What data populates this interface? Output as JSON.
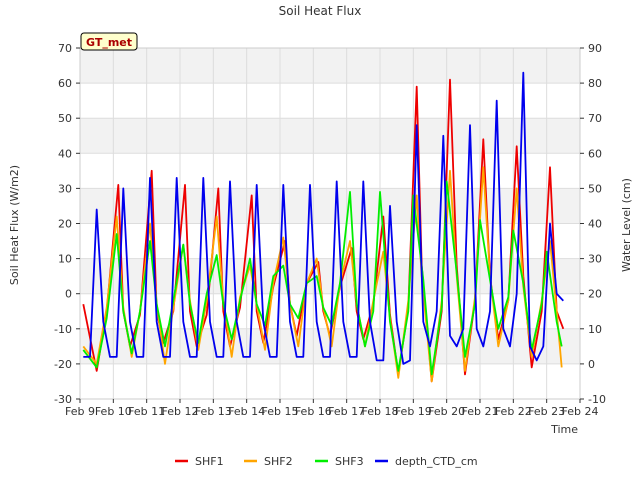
{
  "chart_data": {
    "type": "line",
    "title": "Soil Heat Flux",
    "xlabel": "Time",
    "ylabel": "Soil Heat Flux (W/m2)",
    "y2label": "Water Level (cm)",
    "badge": "GT_met",
    "ylim": [
      -30,
      70
    ],
    "y2lim": [
      -10,
      90
    ],
    "yticks": [
      -30,
      -20,
      -10,
      0,
      10,
      20,
      30,
      40,
      50,
      60,
      70
    ],
    "y2ticks": [
      -10,
      0,
      10,
      20,
      30,
      40,
      50,
      60,
      70,
      80,
      90
    ],
    "xlim": [
      9,
      24
    ],
    "xticks": [
      {
        "x": 9,
        "label": "Feb 9"
      },
      {
        "x": 10,
        "label": "Feb 10"
      },
      {
        "x": 11,
        "label": "Feb 11"
      },
      {
        "x": 12,
        "label": "Feb 12"
      },
      {
        "x": 13,
        "label": "Feb 13"
      },
      {
        "x": 14,
        "label": "Feb 14"
      },
      {
        "x": 15,
        "label": "Feb 15"
      },
      {
        "x": 16,
        "label": "Feb 16"
      },
      {
        "x": 17,
        "label": "Feb 17"
      },
      {
        "x": 18,
        "label": "Feb 18"
      },
      {
        "x": 19,
        "label": "Feb 19"
      },
      {
        "x": 20,
        "label": "Feb 20"
      },
      {
        "x": 21,
        "label": "Feb 21"
      },
      {
        "x": 22,
        "label": "Feb 22"
      },
      {
        "x": 23,
        "label": "Feb 23"
      },
      {
        "x": 24,
        "label": "Feb 24"
      }
    ],
    "grid": true,
    "legend_position": "bottom",
    "series": [
      {
        "name": "SHF1",
        "color": "#ee0000",
        "axis": "left",
        "x": [
          9.1,
          9.5,
          9.8,
          10.15,
          10.3,
          10.5,
          10.8,
          11.15,
          11.3,
          11.5,
          11.8,
          12.15,
          12.3,
          12.5,
          12.8,
          13.15,
          13.3,
          13.5,
          13.8,
          14.15,
          14.3,
          14.5,
          14.8,
          15.15,
          15.3,
          15.5,
          15.8,
          16.15,
          16.3,
          16.5,
          16.8,
          17.15,
          17.3,
          17.5,
          17.8,
          18.1,
          18.3,
          18.55,
          18.85,
          19.1,
          19.25,
          19.55,
          19.85,
          20.1,
          20.3,
          20.55,
          20.85,
          21.1,
          21.3,
          21.55,
          21.85,
          22.1,
          22.3,
          22.55,
          22.85,
          23.1,
          23.3,
          23.5
        ],
        "y": [
          -3,
          -22,
          -5,
          31,
          -5,
          -15,
          -6,
          35,
          -5,
          -14,
          -5,
          31,
          -5,
          -15,
          -6,
          30,
          -5,
          -15,
          -4,
          28,
          -5,
          -14,
          2,
          15,
          -3,
          -12,
          3,
          9,
          -5,
          -12,
          2,
          13,
          -5,
          -13,
          -3,
          22,
          -6,
          -23,
          -4,
          59,
          8,
          -25,
          -5,
          61,
          8,
          -23,
          -2,
          44,
          5,
          -13,
          -2,
          42,
          5,
          -21,
          -5,
          36,
          -5,
          -10
        ]
      },
      {
        "name": "SHF2",
        "color": "#ffa500",
        "axis": "left",
        "x": [
          9.1,
          9.5,
          9.8,
          10.1,
          10.3,
          10.55,
          10.8,
          11.1,
          11.3,
          11.55,
          11.8,
          12.1,
          12.3,
          12.55,
          12.8,
          13.1,
          13.3,
          13.55,
          13.8,
          14.1,
          14.3,
          14.55,
          14.8,
          15.1,
          15.3,
          15.55,
          15.8,
          16.1,
          16.3,
          16.55,
          16.8,
          17.1,
          17.3,
          17.55,
          17.8,
          18.1,
          18.3,
          18.55,
          18.85,
          19.1,
          19.25,
          19.55,
          19.85,
          20.1,
          20.3,
          20.55,
          20.85,
          21.1,
          21.3,
          21.55,
          21.85,
          22.1,
          22.3,
          22.55,
          22.85,
          23.1,
          23.3,
          23.45
        ],
        "y": [
          -15,
          -20,
          -4,
          22,
          -4,
          -18,
          -5,
          20,
          -3,
          -20,
          -4,
          14,
          -2,
          -16,
          -2,
          22,
          -2,
          -18,
          -1,
          8,
          -3,
          -16,
          3,
          16,
          -3,
          -15,
          3,
          10,
          -4,
          -15,
          3,
          15,
          -3,
          -15,
          -2,
          12,
          -7,
          -24,
          -2,
          28,
          5,
          -25,
          -2,
          35,
          5,
          -22,
          -1,
          36,
          5,
          -15,
          -2,
          30,
          2,
          -18,
          -2,
          15,
          -5,
          -21
        ]
      },
      {
        "name": "SHF3",
        "color": "#00ee00",
        "axis": "left",
        "x": [
          9.1,
          9.5,
          9.8,
          10.1,
          10.3,
          10.55,
          10.8,
          11.1,
          11.3,
          11.55,
          11.8,
          12.1,
          12.3,
          12.55,
          12.8,
          13.1,
          13.3,
          13.55,
          13.8,
          14.1,
          14.3,
          14.55,
          14.8,
          15.1,
          15.3,
          15.55,
          15.8,
          16.1,
          16.3,
          16.55,
          16.8,
          17.1,
          17.3,
          17.55,
          17.8,
          18.0,
          18.3,
          18.55,
          18.85,
          19.0,
          19.3,
          19.55,
          19.85,
          20.0,
          20.3,
          20.55,
          20.85,
          21.0,
          21.3,
          21.55,
          21.85,
          22.0,
          22.3,
          22.55,
          22.85,
          23.0,
          23.3,
          23.45
        ],
        "y": [
          -16,
          -21,
          -7,
          17,
          -5,
          -17,
          -5,
          15,
          -3,
          -15,
          -2,
          14,
          -3,
          -14,
          0,
          11,
          -3,
          -13,
          -2,
          10,
          -3,
          -9,
          5,
          8,
          -3,
          -7,
          3,
          5,
          -4,
          -9,
          3,
          29,
          -3,
          -15,
          -5,
          29,
          -8,
          -22,
          -5,
          28,
          4,
          -23,
          -4,
          32,
          6,
          -18,
          -3,
          21,
          4,
          -10,
          -1,
          18,
          3,
          -16,
          -3,
          12,
          -8,
          -15
        ]
      },
      {
        "name": "depth_CTD_cm",
        "color": "#0000ee",
        "axis": "right",
        "x": [
          9.1,
          9.3,
          9.5,
          9.7,
          9.9,
          10.1,
          10.3,
          10.5,
          10.7,
          10.9,
          11.1,
          11.3,
          11.5,
          11.7,
          11.9,
          12.1,
          12.3,
          12.5,
          12.7,
          12.9,
          13.1,
          13.3,
          13.5,
          13.7,
          13.9,
          14.1,
          14.3,
          14.5,
          14.7,
          14.9,
          15.1,
          15.3,
          15.5,
          15.7,
          15.9,
          16.1,
          16.3,
          16.5,
          16.7,
          16.9,
          17.1,
          17.3,
          17.5,
          17.7,
          17.9,
          18.1,
          18.3,
          18.5,
          18.7,
          18.9,
          19.1,
          19.3,
          19.5,
          19.7,
          19.9,
          20.1,
          20.3,
          20.5,
          20.7,
          20.9,
          21.1,
          21.3,
          21.5,
          21.7,
          21.9,
          22.1,
          22.3,
          22.5,
          22.7,
          22.9,
          23.1,
          23.3,
          23.5
        ],
        "y": [
          2,
          2,
          44,
          12,
          2,
          2,
          50,
          12,
          2,
          2,
          53,
          12,
          2,
          2,
          53,
          12,
          2,
          2,
          53,
          12,
          2,
          2,
          52,
          12,
          2,
          2,
          51,
          12,
          2,
          2,
          51,
          12,
          2,
          2,
          51,
          12,
          2,
          2,
          52,
          12,
          2,
          2,
          52,
          12,
          1,
          1,
          45,
          12,
          0,
          1,
          68,
          12,
          5,
          15,
          65,
          8,
          5,
          10,
          68,
          10,
          5,
          15,
          75,
          10,
          5,
          20,
          83,
          5,
          1,
          5,
          40,
          20,
          18
        ]
      }
    ]
  }
}
